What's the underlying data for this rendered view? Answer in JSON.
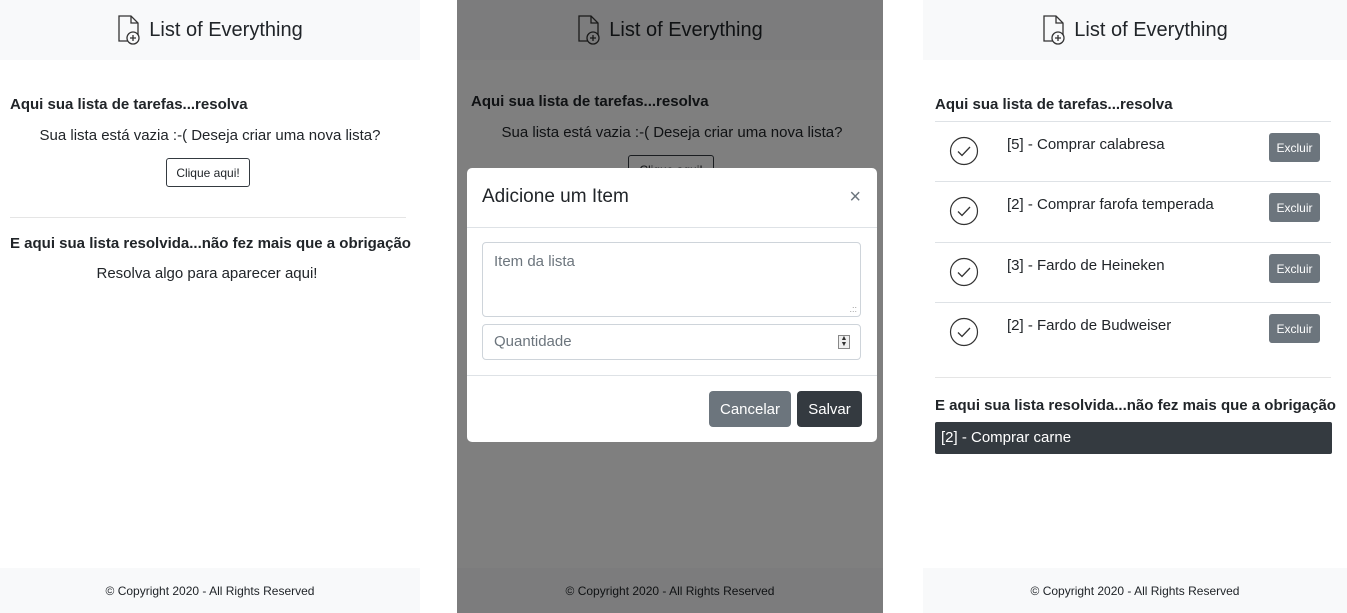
{
  "app": {
    "title": "List of Everything",
    "footer": "© Copyright 2020 - All Rights Reserved"
  },
  "screen1": {
    "todo_heading": "Aqui sua lista de tarefas...resolva",
    "empty_message": "Sua lista está vazia :-( Deseja criar uma nova lista?",
    "create_button": "Clique aqui!",
    "done_heading": "E aqui sua lista resolvida...não fez mais que a obrigação",
    "done_empty_message": "Resolva algo para aparecer aqui!"
  },
  "screen2": {
    "todo_heading": "Aqui sua lista de tarefas...resolva",
    "empty_message": "Sua lista está vazia :-( Deseja criar uma nova lista?",
    "create_button_partial": "Clique aqui!",
    "modal": {
      "title": "Adicione um Item",
      "close": "×",
      "item_placeholder": "Item da lista",
      "quantity_placeholder": "Quantidade",
      "cancel_label": "Cancelar",
      "save_label": "Salvar"
    }
  },
  "screen3": {
    "todo_heading": "Aqui sua lista de tarefas...resolva",
    "tasks": [
      {
        "label": "[5] - Comprar calabresa",
        "delete_label": "Excluir"
      },
      {
        "label": "[2] - Comprar farofa temperada",
        "delete_label": "Excluir"
      },
      {
        "label": "[3] - Fardo de Heineken",
        "delete_label": "Excluir"
      },
      {
        "label": "[2] - Fardo de Budweiser",
        "delete_label": "Excluir"
      }
    ],
    "done_heading": "E aqui sua lista resolvida...não fez mais que a obrigação",
    "done_items": [
      {
        "label": "[2] - Comprar carne"
      }
    ]
  },
  "colors": {
    "header_bg": "#f8f9fa",
    "dark": "#343a40",
    "secondary": "#6c757d",
    "overlay": "rgba(0,0,0,0.5)"
  }
}
